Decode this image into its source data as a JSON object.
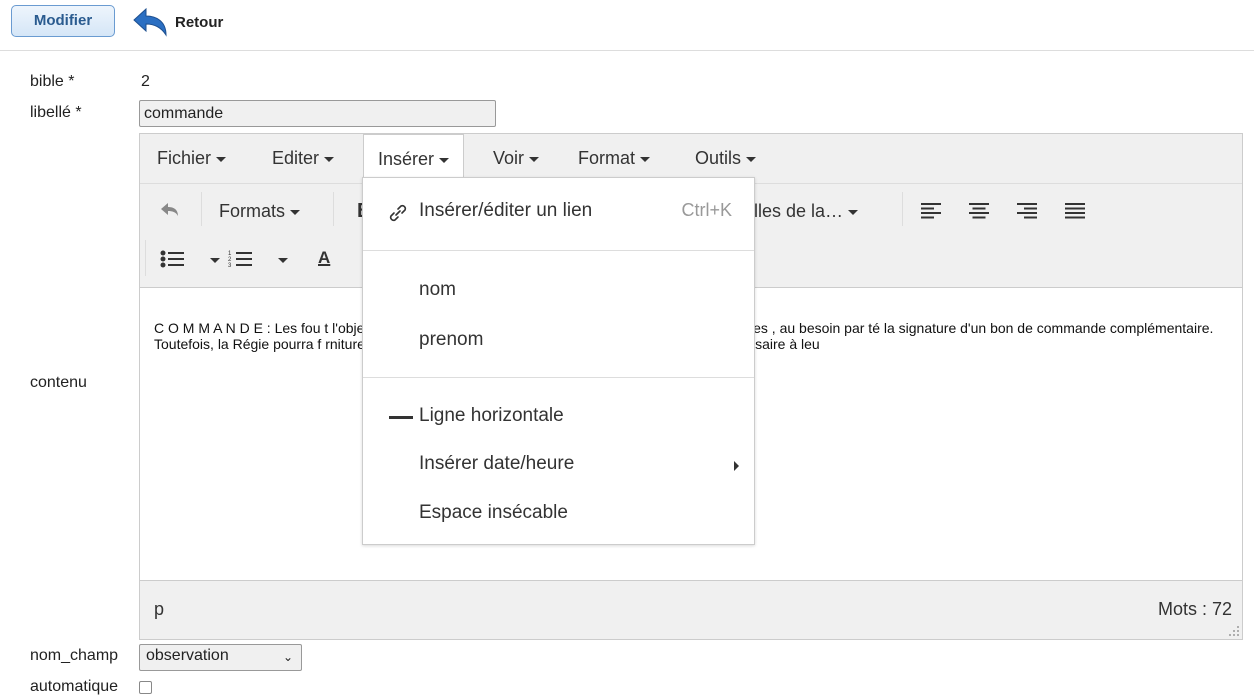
{
  "topbar": {
    "modifier_label": "Modifier",
    "retour_label": "Retour"
  },
  "form": {
    "bible_label": "bible *",
    "bible_value": "2",
    "libelle_label": "libellé *",
    "libelle_value": "commande",
    "contenu_label": "contenu",
    "nom_champ_label": "nom_champ",
    "nom_champ_value": "observation",
    "automatique_label": "automatique"
  },
  "editor": {
    "menus": [
      "Fichier",
      "Editer",
      "Insérer",
      "Voir",
      "Format",
      "Outils"
    ],
    "active_menu": "Insérer",
    "toolbar": {
      "formats_label": "Formats",
      "styles_label": "lles de la…"
    },
    "content_text": "C O M M A N D E : Les fou                                                                                                           t l'objet d'un bon de commande signé par la ou les personnes habilitées , au besoin par té                                                                                            la signature d'un bon de commande complémentaire. Toutefois, la Régie pourra f                                                                                                rniture et/ou prestation qui, au moment des travaux, s'avérerait nécessaire à leu",
    "content_lines": [
      {
        "left": "C O M M A N D E : Les fou",
        "right": "t l'objet d'un bon de commande signé par la ou les personnes"
      },
      {
        "left": "habilitées , au besoin par té",
        "right": "la signature d'un bon de commande complémentaire."
      },
      {
        "left": "Toutefois, la Régie pourra f",
        "right": "rniture et/ou prestation qui, au moment des travaux,"
      },
      {
        "left": "s'avérerait nécessaire à leu",
        "right": ""
      }
    ],
    "status_path": "p",
    "word_count": "Mots : 72"
  },
  "dropdown": {
    "link_label": "Insérer/éditer un lien",
    "link_shortcut": "Ctrl+K",
    "nom_label": "nom",
    "prenom_label": "prenom",
    "hr_label": "Ligne horizontale",
    "date_label": "Insérer date/heure",
    "nbsp_label": "Espace insécable"
  },
  "icons": {
    "retour": "undo-arrow-icon",
    "link": "link-icon",
    "hr": "horizontal-line-icon",
    "submenu": "chevron-right-icon"
  },
  "colors": {
    "accent": "#2a5b8f",
    "retour_arrow": "#2b6fc2"
  }
}
